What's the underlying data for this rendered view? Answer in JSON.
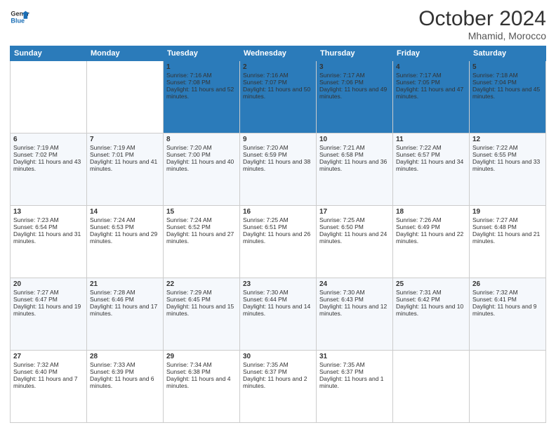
{
  "header": {
    "logo_line1": "General",
    "logo_line2": "Blue",
    "month": "October 2024",
    "location": "Mhamid, Morocco"
  },
  "days_of_week": [
    "Sunday",
    "Monday",
    "Tuesday",
    "Wednesday",
    "Thursday",
    "Friday",
    "Saturday"
  ],
  "weeks": [
    [
      {
        "day": "",
        "info": ""
      },
      {
        "day": "",
        "info": ""
      },
      {
        "day": "1",
        "info": "Sunrise: 7:16 AM\nSunset: 7:08 PM\nDaylight: 11 hours and 52 minutes."
      },
      {
        "day": "2",
        "info": "Sunrise: 7:16 AM\nSunset: 7:07 PM\nDaylight: 11 hours and 50 minutes."
      },
      {
        "day": "3",
        "info": "Sunrise: 7:17 AM\nSunset: 7:06 PM\nDaylight: 11 hours and 49 minutes."
      },
      {
        "day": "4",
        "info": "Sunrise: 7:17 AM\nSunset: 7:05 PM\nDaylight: 11 hours and 47 minutes."
      },
      {
        "day": "5",
        "info": "Sunrise: 7:18 AM\nSunset: 7:04 PM\nDaylight: 11 hours and 45 minutes."
      }
    ],
    [
      {
        "day": "6",
        "info": "Sunrise: 7:19 AM\nSunset: 7:02 PM\nDaylight: 11 hours and 43 minutes."
      },
      {
        "day": "7",
        "info": "Sunrise: 7:19 AM\nSunset: 7:01 PM\nDaylight: 11 hours and 41 minutes."
      },
      {
        "day": "8",
        "info": "Sunrise: 7:20 AM\nSunset: 7:00 PM\nDaylight: 11 hours and 40 minutes."
      },
      {
        "day": "9",
        "info": "Sunrise: 7:20 AM\nSunset: 6:59 PM\nDaylight: 11 hours and 38 minutes."
      },
      {
        "day": "10",
        "info": "Sunrise: 7:21 AM\nSunset: 6:58 PM\nDaylight: 11 hours and 36 minutes."
      },
      {
        "day": "11",
        "info": "Sunrise: 7:22 AM\nSunset: 6:57 PM\nDaylight: 11 hours and 34 minutes."
      },
      {
        "day": "12",
        "info": "Sunrise: 7:22 AM\nSunset: 6:55 PM\nDaylight: 11 hours and 33 minutes."
      }
    ],
    [
      {
        "day": "13",
        "info": "Sunrise: 7:23 AM\nSunset: 6:54 PM\nDaylight: 11 hours and 31 minutes."
      },
      {
        "day": "14",
        "info": "Sunrise: 7:24 AM\nSunset: 6:53 PM\nDaylight: 11 hours and 29 minutes."
      },
      {
        "day": "15",
        "info": "Sunrise: 7:24 AM\nSunset: 6:52 PM\nDaylight: 11 hours and 27 minutes."
      },
      {
        "day": "16",
        "info": "Sunrise: 7:25 AM\nSunset: 6:51 PM\nDaylight: 11 hours and 26 minutes."
      },
      {
        "day": "17",
        "info": "Sunrise: 7:25 AM\nSunset: 6:50 PM\nDaylight: 11 hours and 24 minutes."
      },
      {
        "day": "18",
        "info": "Sunrise: 7:26 AM\nSunset: 6:49 PM\nDaylight: 11 hours and 22 minutes."
      },
      {
        "day": "19",
        "info": "Sunrise: 7:27 AM\nSunset: 6:48 PM\nDaylight: 11 hours and 21 minutes."
      }
    ],
    [
      {
        "day": "20",
        "info": "Sunrise: 7:27 AM\nSunset: 6:47 PM\nDaylight: 11 hours and 19 minutes."
      },
      {
        "day": "21",
        "info": "Sunrise: 7:28 AM\nSunset: 6:46 PM\nDaylight: 11 hours and 17 minutes."
      },
      {
        "day": "22",
        "info": "Sunrise: 7:29 AM\nSunset: 6:45 PM\nDaylight: 11 hours and 15 minutes."
      },
      {
        "day": "23",
        "info": "Sunrise: 7:30 AM\nSunset: 6:44 PM\nDaylight: 11 hours and 14 minutes."
      },
      {
        "day": "24",
        "info": "Sunrise: 7:30 AM\nSunset: 6:43 PM\nDaylight: 11 hours and 12 minutes."
      },
      {
        "day": "25",
        "info": "Sunrise: 7:31 AM\nSunset: 6:42 PM\nDaylight: 11 hours and 10 minutes."
      },
      {
        "day": "26",
        "info": "Sunrise: 7:32 AM\nSunset: 6:41 PM\nDaylight: 11 hours and 9 minutes."
      }
    ],
    [
      {
        "day": "27",
        "info": "Sunrise: 7:32 AM\nSunset: 6:40 PM\nDaylight: 11 hours and 7 minutes."
      },
      {
        "day": "28",
        "info": "Sunrise: 7:33 AM\nSunset: 6:39 PM\nDaylight: 11 hours and 6 minutes."
      },
      {
        "day": "29",
        "info": "Sunrise: 7:34 AM\nSunset: 6:38 PM\nDaylight: 11 hours and 4 minutes."
      },
      {
        "day": "30",
        "info": "Sunrise: 7:35 AM\nSunset: 6:37 PM\nDaylight: 11 hours and 2 minutes."
      },
      {
        "day": "31",
        "info": "Sunrise: 7:35 AM\nSunset: 6:37 PM\nDaylight: 11 hours and 1 minute."
      },
      {
        "day": "",
        "info": ""
      },
      {
        "day": "",
        "info": ""
      }
    ]
  ]
}
